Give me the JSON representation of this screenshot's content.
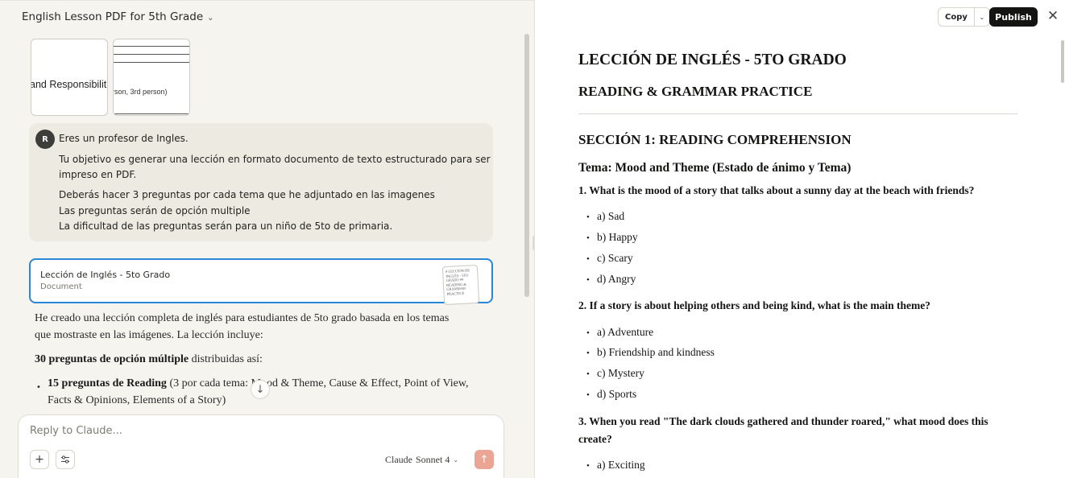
{
  "conversation": {
    "title": "English Lesson PDF for 5th Grade"
  },
  "attachments": [
    {
      "preview_text": "and Responsibiliti"
    },
    {
      "preview_text": "rson, 3rd person)"
    }
  ],
  "user_message": {
    "avatar_initial": "R",
    "lines": [
      "Eres un profesor de Ingles.",
      "Tu objetivo es generar una lección en formato documento de texto estructurado para ser",
      "impreso en PDF.",
      "Deberás hacer 3 preguntas por cada tema que he adjuntado en las imagenes",
      "Las preguntas serán de opción multiple",
      "La dificultad de las preguntas serán para un niño de 5to de primaria."
    ]
  },
  "artifact_card": {
    "title": "Lección de Inglés - 5to Grado",
    "type": "Document",
    "preview_text": "# LECCIÓN DE INGLÉS - 5TO GRADO ## READING & GRAMMAR PRACTICE"
  },
  "assistant_response": {
    "line1": "He creado una lección completa de inglés para estudiantes de 5to grado basada en los temas",
    "line2": "que mostraste en las imágenes. La lección incluye:",
    "summary_bold": "30 preguntas de opción múltiple",
    "summary_rest": " distribuidas así:",
    "bullet_bold": "15 preguntas de Reading",
    "bullet_rest_1": " (3 por cada tema: Mood & Theme, Cause & Effect, Point of View,",
    "bullet_rest_2": "Facts & Opinions, Elements of a Story)"
  },
  "composer": {
    "placeholder": "Reply to Claude...",
    "model_brand": "Claude",
    "model_name": "Sonnet 4"
  },
  "toolbar": {
    "copy_label": "Copy",
    "publish_label": "Publish"
  },
  "icons": {
    "chevron": "chevron-down-icon",
    "plus": "plus-icon",
    "tools": "sliders-icon",
    "send": "arrow-up-icon",
    "close": "close-icon",
    "scroll": "arrow-down-icon"
  },
  "colors": {
    "accent_border": "#2a86d6",
    "send_button": "#eba594",
    "publish_button": "#141413"
  },
  "document": {
    "title": "LECCIÓN DE INGLÉS - 5TO GRADO",
    "subtitle": "READING & GRAMMAR PRACTICE",
    "section": "SECCIÓN 1: READING COMPREHENSION",
    "theme": "Tema: Mood and Theme (Estado de ánimo y Tema)",
    "questions": [
      {
        "text": "1. What is the mood of a story that talks about a sunny day at the beach with friends?",
        "options": [
          "a) Sad",
          "b) Happy",
          "c) Scary",
          "d) Angry"
        ]
      },
      {
        "text": "2. If a story is about helping others and being kind, what is the main theme?",
        "options": [
          "a) Adventure",
          "b) Friendship and kindness",
          "c) Mystery",
          "d) Sports"
        ]
      },
      {
        "text": "3. When you read \"The dark clouds gathered and thunder roared,\" what mood does this create?",
        "options": [
          "a) Exciting"
        ]
      }
    ]
  }
}
